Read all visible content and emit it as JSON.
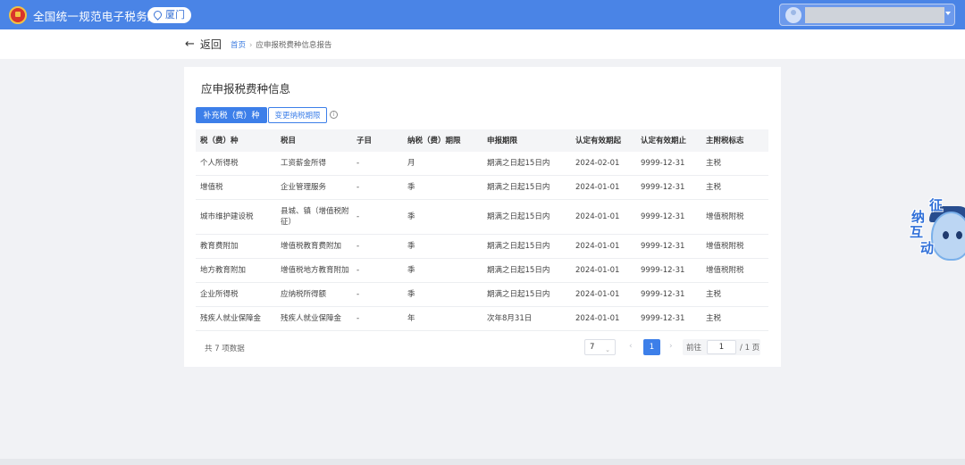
{
  "header": {
    "brand": "全国统一规范电子税务局",
    "city": "厦门",
    "colors": {
      "bar": "#4a84e6",
      "accent": "#3d7fe9"
    }
  },
  "nav": {
    "back_label": "返回",
    "breadcrumb": [
      "首页",
      "应申报税费种信息报告"
    ]
  },
  "card": {
    "title": "应申报税费种信息",
    "buttons": {
      "supplement": "补充税（费）种",
      "change_period": "变更纳税期限"
    }
  },
  "table": {
    "columns": [
      "税（费）种",
      "税目",
      "子目",
      "纳税（费）期限",
      "申报期限",
      "认定有效期起",
      "认定有效期止",
      "主附税标志"
    ],
    "rows": [
      [
        "个人所得税",
        "工资薪金所得",
        "-",
        "月",
        "期满之日起15日内",
        "2024-02-01",
        "9999-12-31",
        "主税"
      ],
      [
        "增值税",
        "企业管理服务",
        "-",
        "季",
        "期满之日起15日内",
        "2024-01-01",
        "9999-12-31",
        "主税"
      ],
      [
        "城市维护建设税",
        "县城、镇（增值税附征）",
        "-",
        "季",
        "期满之日起15日内",
        "2024-01-01",
        "9999-12-31",
        "增值税附税"
      ],
      [
        "教育费附加",
        "增值税教育费附加",
        "-",
        "季",
        "期满之日起15日内",
        "2024-01-01",
        "9999-12-31",
        "增值税附税"
      ],
      [
        "地方教育附加",
        "增值税地方教育附加",
        "-",
        "季",
        "期满之日起15日内",
        "2024-01-01",
        "9999-12-31",
        "增值税附税"
      ],
      [
        "企业所得税",
        "应纳税所得额",
        "-",
        "季",
        "期满之日起15日内",
        "2024-01-01",
        "9999-12-31",
        "主税"
      ],
      [
        "残疾人就业保障金",
        "残疾人就业保障金",
        "-",
        "年",
        "次年8月31日",
        "2024-01-01",
        "9999-12-31",
        "主税"
      ]
    ]
  },
  "pagination": {
    "total_text": "共 7 项数据",
    "page_size": "7",
    "current_page": "1",
    "goto_label": "前往",
    "goto_value": "1",
    "total_pages": "/ 1 页"
  },
  "mascot": {
    "chars": [
      "征",
      "纳",
      "互",
      "动"
    ]
  }
}
